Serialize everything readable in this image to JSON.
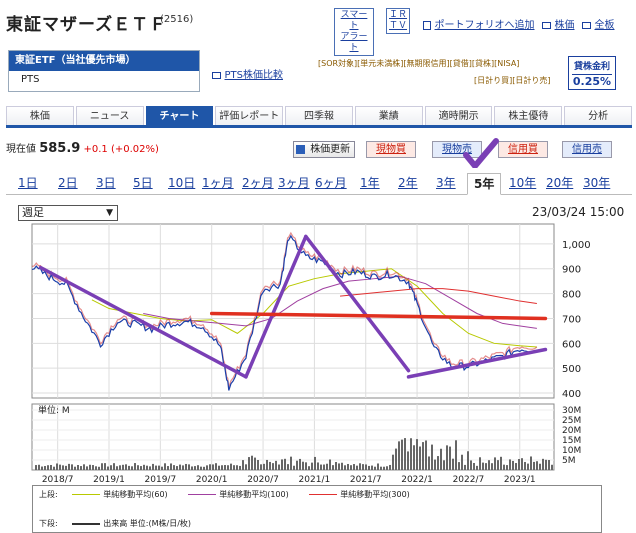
{
  "header": {
    "title": "東証マザーズＥＴＦ",
    "code": "(2516)",
    "smart_alert": [
      "スマート",
      "アラート"
    ],
    "ir_tv": [
      "ＩＲ",
      "ＴＶ"
    ],
    "portfolio_link": "ポートフォリオへ追加",
    "kabuka_link": "株価",
    "zenban_link": "全板",
    "pts_compare": "PTS株価比較"
  },
  "market": {
    "selected": "東証ETF（当社優先市場）",
    "pts": "PTS"
  },
  "tags": {
    "line1": "[SOR対象][単元未満株][無期限信用][貸借][貸株][NISA]",
    "line2": "[日計り買][日計り売]"
  },
  "lending_rate": {
    "label": "貸株金利",
    "value": "0.25%"
  },
  "tabs": [
    "株価",
    "ニュース",
    "チャート",
    "評価レポート",
    "四季報",
    "業績",
    "適時開示",
    "株主優待",
    "分析"
  ],
  "active_tab": 2,
  "price": {
    "label": "現在値",
    "value": "585.9",
    "change": "+0.1 (+0.02%)",
    "update_button": "株価更新",
    "buy_spot": "現物買",
    "sell_spot": "現物売",
    "buy_margin": "信用買",
    "sell_margin": "信用売"
  },
  "periods": [
    "1日",
    "2日",
    "3日",
    "5日",
    "10日",
    "1ヶ月",
    "2ヶ月",
    "3ヶ月",
    "6ヶ月",
    "1年",
    "2年",
    "3年",
    "5年",
    "10年",
    "20年",
    "30年"
  ],
  "active_period": "5年",
  "period_select": "週足",
  "datetime": "23/03/24 15:00",
  "chart_data": {
    "type": "line",
    "price_axis": [
      400,
      500,
      600,
      700,
      800,
      900,
      1000
    ],
    "price_tick_labels": [
      "400",
      "500",
      "600",
      "700",
      "800",
      "900",
      "1,000"
    ],
    "volume_tick_labels": [
      "5M",
      "10M",
      "15M",
      "20M",
      "25M",
      "30M"
    ],
    "volume_unit_label": "単位: M",
    "x_tick_labels": [
      "2018/7",
      "2019/1",
      "2019/7",
      "2020/1",
      "2020/7",
      "2021/1",
      "2021/7",
      "2022/1",
      "2022/7",
      "2023/1"
    ],
    "ylim": [
      380,
      1080
    ],
    "series": [
      {
        "name": "単純移動平均(60)",
        "color": "#b8c900",
        "x": [
          "2018/11",
          "2019/1",
          "2019/4",
          "2019/7",
          "2019/10",
          "2020/1",
          "2020/4",
          "2020/7",
          "2020/10",
          "2021/1",
          "2021/4",
          "2021/7",
          "2021/10",
          "2022/1",
          "2022/4",
          "2022/7",
          "2022/10",
          "2023/1",
          "2023/3"
        ],
        "values": [
          775,
          740,
          720,
          700,
          690,
          695,
          640,
          720,
          830,
          860,
          880,
          890,
          900,
          830,
          720,
          640,
          600,
          590,
          585
        ]
      },
      {
        "name": "単純移動平均(100)",
        "color": "#a040a0",
        "x": [
          "2019/5",
          "2019/8",
          "2019/11",
          "2020/2",
          "2020/5",
          "2020/8",
          "2020/11",
          "2021/2",
          "2021/5",
          "2021/8",
          "2021/11",
          "2022/2",
          "2022/5",
          "2022/8",
          "2022/11",
          "2023/3"
        ],
        "values": [
          720,
          700,
          690,
          680,
          670,
          700,
          770,
          820,
          850,
          860,
          870,
          840,
          780,
          720,
          680,
          660
        ]
      },
      {
        "name": "単純移動平均(300)",
        "color": "#e03030",
        "x": [
          "2021/4",
          "2021/7",
          "2021/10",
          "2022/1",
          "2022/4",
          "2022/7",
          "2022/10",
          "2023/1",
          "2023/3"
        ],
        "values": [
          790,
          800,
          810,
          820,
          820,
          810,
          790,
          770,
          760
        ]
      },
      {
        "name": "price",
        "color": "#1a3faa",
        "x": [
          "2018/4",
          "2018/6",
          "2018/8",
          "2018/10",
          "2018/12",
          "2019/2",
          "2019/4",
          "2019/6",
          "2019/8",
          "2019/10",
          "2019/12",
          "2020/2",
          "2020/3",
          "2020/5",
          "2020/7",
          "2020/9",
          "2020/10",
          "2020/12",
          "2021/2",
          "2021/4",
          "2021/6",
          "2021/8",
          "2021/10",
          "2021/12",
          "2022/1",
          "2022/3",
          "2022/5",
          "2022/7",
          "2022/9",
          "2022/11",
          "2023/1",
          "2023/3"
        ],
        "values": [
          920,
          880,
          850,
          720,
          610,
          700,
          690,
          670,
          690,
          700,
          680,
          600,
          430,
          560,
          830,
          850,
          1040,
          960,
          940,
          890,
          900,
          880,
          890,
          860,
          770,
          590,
          520,
          520,
          540,
          560,
          590,
          585
        ]
      }
    ],
    "annotations": [
      {
        "type": "trendline",
        "color": "#7a3fb5",
        "points": [
          [
            "2018/5",
            905
          ],
          [
            "2020/5",
            465
          ]
        ]
      },
      {
        "type": "trendline",
        "color": "#7a3fb5",
        "points": [
          [
            "2020/5",
            465
          ],
          [
            "2020/12",
            1030
          ]
        ]
      },
      {
        "type": "trendline",
        "color": "#7a3fb5",
        "points": [
          [
            "2020/12",
            1030
          ],
          [
            "2021/12",
            490
          ]
        ]
      },
      {
        "type": "trendline",
        "color": "#7a3fb5",
        "points": [
          [
            "2021/12",
            465
          ],
          [
            "2023/4",
            575
          ]
        ]
      },
      {
        "type": "hline",
        "color": "#e03020",
        "points": [
          [
            "2020/1",
            720
          ],
          [
            "2023/4",
            700
          ]
        ]
      }
    ]
  },
  "legend": {
    "upper_label": "上段:",
    "lower_label": "下段:",
    "ma60": "単純移動平均(60)",
    "ma100": "単純移動平均(100)",
    "ma300": "単純移動平均(300)",
    "volume": "出来高 単位:(M株/日/枚)"
  }
}
